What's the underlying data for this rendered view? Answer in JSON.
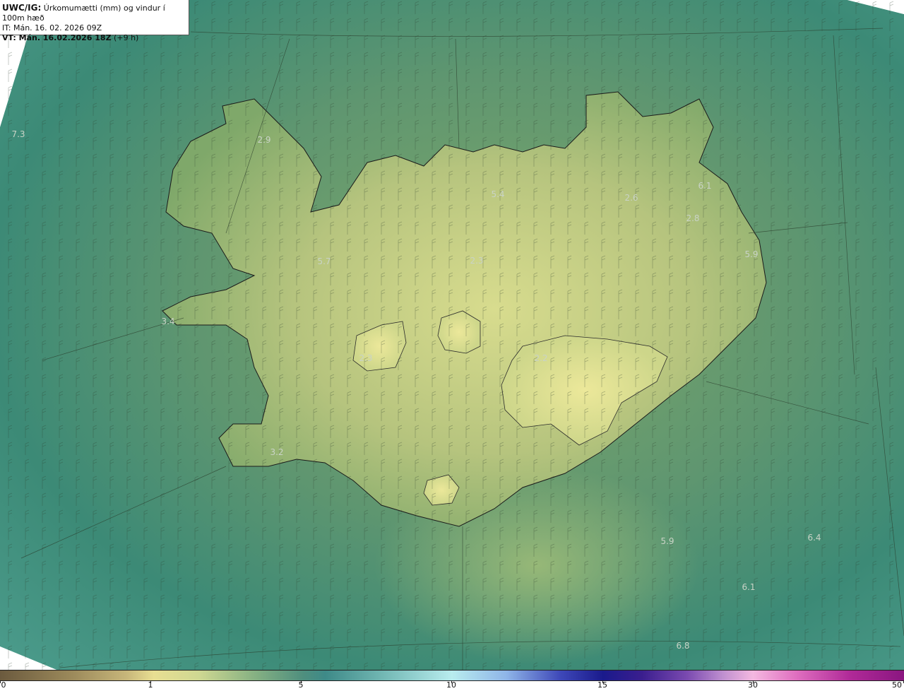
{
  "header": {
    "line1_bold": "UWC/IG:",
    "line1_rest": " Úrkomumætti (mm) og vindur í 100m hæð",
    "line2": "IT: Mán. 16. 02. 2026 09Z",
    "line3_bold": "VT: Mán. 16.02.2026 18Z",
    "line3_rest": " (+9 h)"
  },
  "map_labels": [
    "7.3",
    "2.9",
    "5.4",
    "2.6",
    "6.1",
    "2.8",
    "5.7",
    "2.3",
    "5.9",
    "3.4",
    "2.3",
    "2.2",
    "3.2",
    "5.9",
    "6.4",
    "6.1",
    "6.8"
  ],
  "colorbar": {
    "ticks": [
      "0",
      "1",
      "5",
      "10",
      "15",
      "30",
      "50"
    ]
  },
  "colors": {
    "ocean": "#3f8a74",
    "land_low": "#7fa86a",
    "land_high": "#d8dc8e",
    "coastline": "#1a1a1a",
    "label": "#c9d3c6"
  }
}
